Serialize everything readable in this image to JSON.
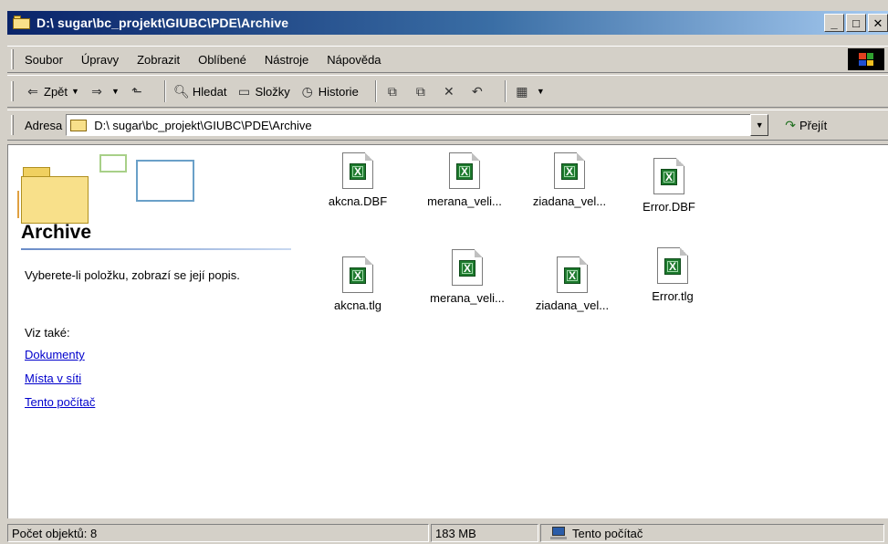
{
  "window": {
    "title": "D:\\ sugar\\bc_projekt\\GIUBC\\PDE\\Archive",
    "buttons": {
      "minimize": "_",
      "maximize": "□",
      "close": "✕"
    }
  },
  "menubar": {
    "items": [
      "Soubor",
      "Úpravy",
      "Zobrazit",
      "Oblíbené",
      "Nástroje",
      "Nápověda"
    ]
  },
  "toolbar": {
    "back": "Zpět",
    "search": "Hledat",
    "folders": "Složky",
    "history": "Historie"
  },
  "addressbar": {
    "label": "Adresa",
    "value": "D:\\ sugar\\bc_projekt\\GIUBC\\PDE\\Archive",
    "go": "Přejít"
  },
  "panel": {
    "title": "Archive",
    "description": "Vyberete-li položku, zobrazí se její popis.",
    "see_also": "Viz také:",
    "links": [
      "Dokumenty",
      "Místa v síti",
      "Tento počítač"
    ]
  },
  "files": [
    {
      "name": "akcna.DBF"
    },
    {
      "name": "merana_veli..."
    },
    {
      "name": "ziadana_vel..."
    },
    {
      "name": "Error.DBF"
    },
    {
      "name": "akcna.tlg"
    },
    {
      "name": "merana_veli..."
    },
    {
      "name": "ziadana_vel..."
    },
    {
      "name": "Error.tlg"
    }
  ],
  "status": {
    "count": "Počet objektů: 8",
    "size": "183 MB",
    "location": "Tento počítač"
  },
  "colors": {
    "titlebar_start": "#0a246a",
    "titlebar_end": "#a6caf0",
    "chrome": "#d4d0c8",
    "link": "#0000cc"
  }
}
